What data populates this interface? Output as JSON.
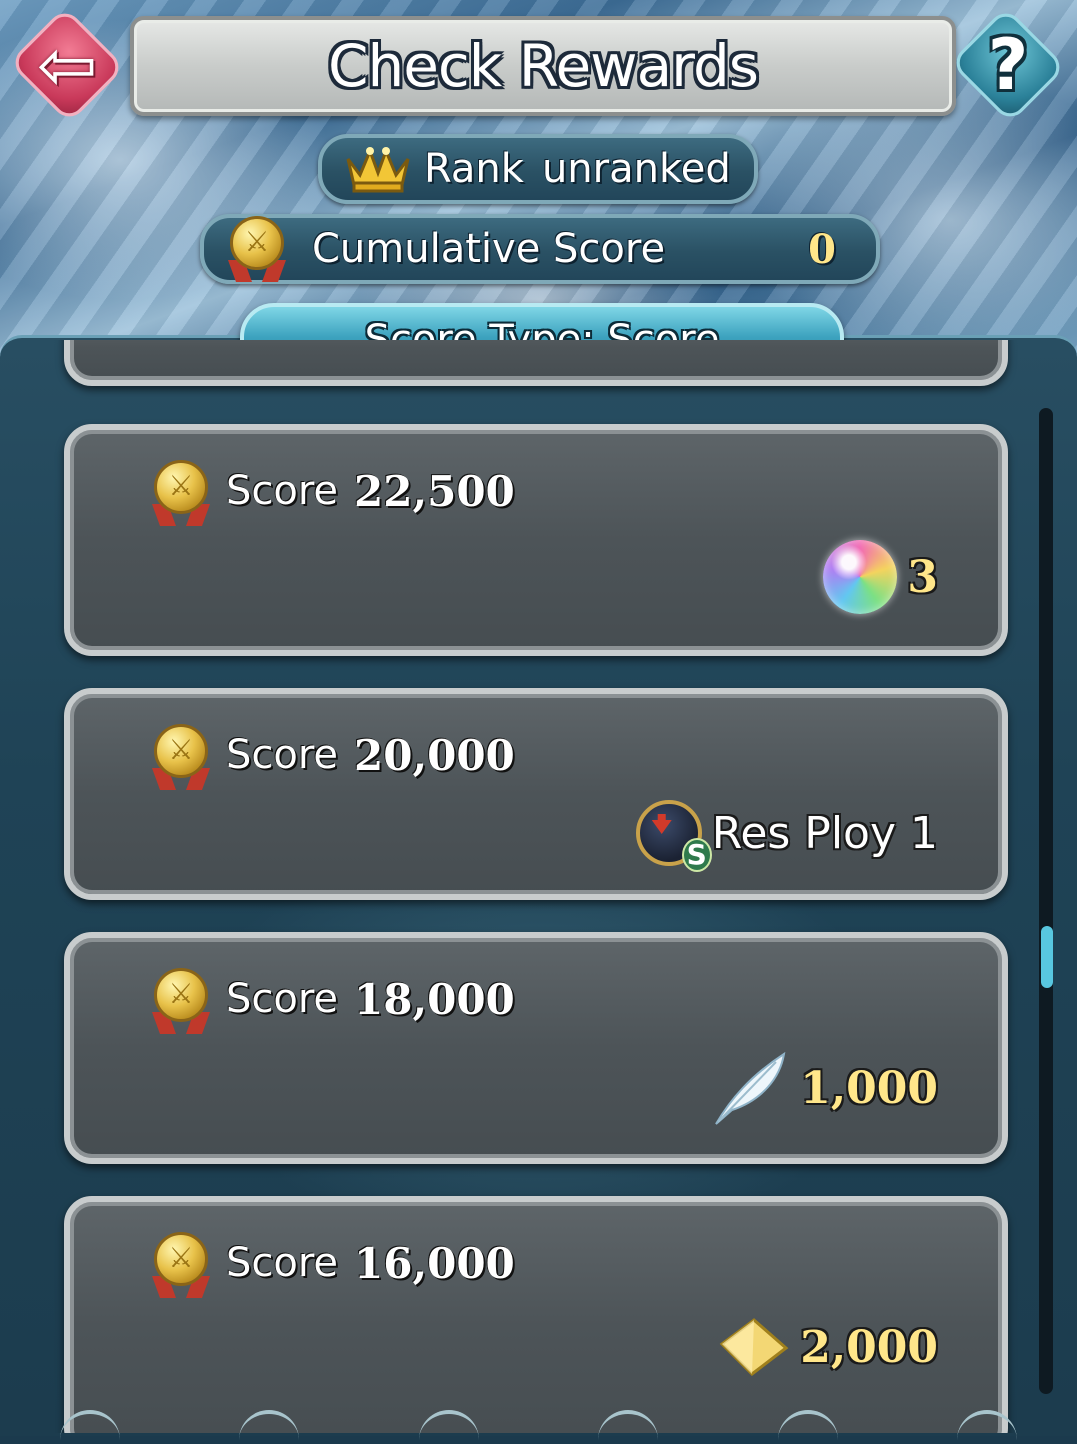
{
  "header": {
    "title": "Check Rewards",
    "back_icon": "back-arrow-icon",
    "help_label": "?"
  },
  "rank": {
    "label": "Rank",
    "value": "unranked",
    "icon": "crown-icon"
  },
  "cumulative": {
    "label": "Cumulative Score",
    "value": "0",
    "icon": "medal-icon"
  },
  "score_type_button": {
    "label": "Score Type: Score"
  },
  "rewards": [
    {
      "label": "Score",
      "amount": "22,500",
      "reward_icon": "orb-icon",
      "reward_text": "3"
    },
    {
      "label": "Score",
      "amount": "20,000",
      "reward_icon": "skill-scroll-icon",
      "reward_text": "Res Ploy 1"
    },
    {
      "label": "Score",
      "amount": "18,000",
      "reward_icon": "feather-icon",
      "reward_text": "1,000"
    },
    {
      "label": "Score",
      "amount": "16,000",
      "reward_icon": "crystal-icon",
      "reward_text": "2,000"
    }
  ],
  "colors": {
    "reward_value": "#ffe68a",
    "accent_button": "#3da3bf",
    "back_button": "#c9395a",
    "help_button": "#2b8199"
  },
  "scroll": {
    "position_fraction": 0.53
  }
}
